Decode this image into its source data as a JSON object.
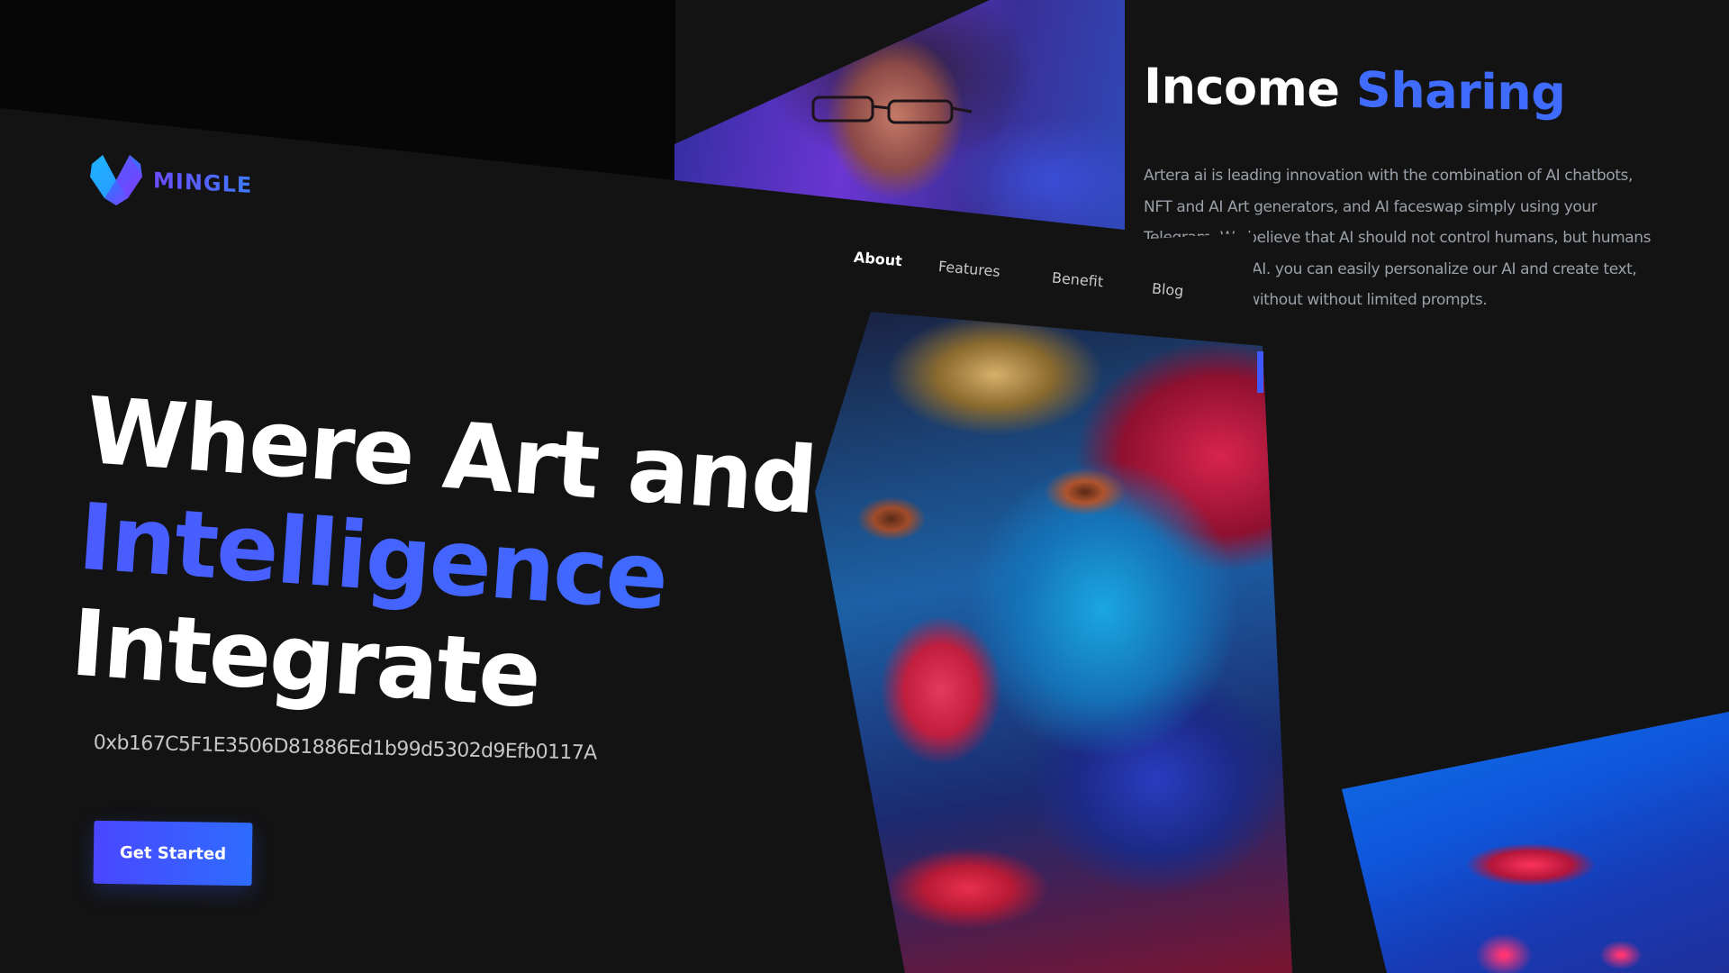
{
  "brand": {
    "name": "MINGLE",
    "logo_icon": "mingle-logo-icon",
    "colors": {
      "accent": "#3f6cff",
      "background": "#131313",
      "cta_start": "#4a47ff",
      "cta_end": "#2e6cff"
    }
  },
  "nav": {
    "items": [
      {
        "label": "About",
        "active": true
      },
      {
        "label": "Features",
        "active": false
      },
      {
        "label": "Benefit",
        "active": false
      },
      {
        "label": "Blog",
        "active": false
      }
    ]
  },
  "income": {
    "title_plain": "Income",
    "title_accent": "Sharing",
    "body": "Artera ai is leading innovation with the combination of AI chatbots, NFT and AI Art generators, and AI faceswap simply using your Telegram. We believe that AI should not control humans, but humans should control AI. you can easily personalize our AI and create text, images freely without without limited prompts."
  },
  "hero": {
    "line1": "Where Art and",
    "line2": "Intelligence",
    "line3": "Integrate",
    "wallet_address": "0xb167C5F1E3506D81886Ed1b99d5302d9Efb0117A",
    "cta_label": "Get Started"
  },
  "images": {
    "portrait_man": "portrait-man-image",
    "painted_face": "painted-face-image",
    "painted_face_closeup": "painted-face-closeup-image"
  }
}
